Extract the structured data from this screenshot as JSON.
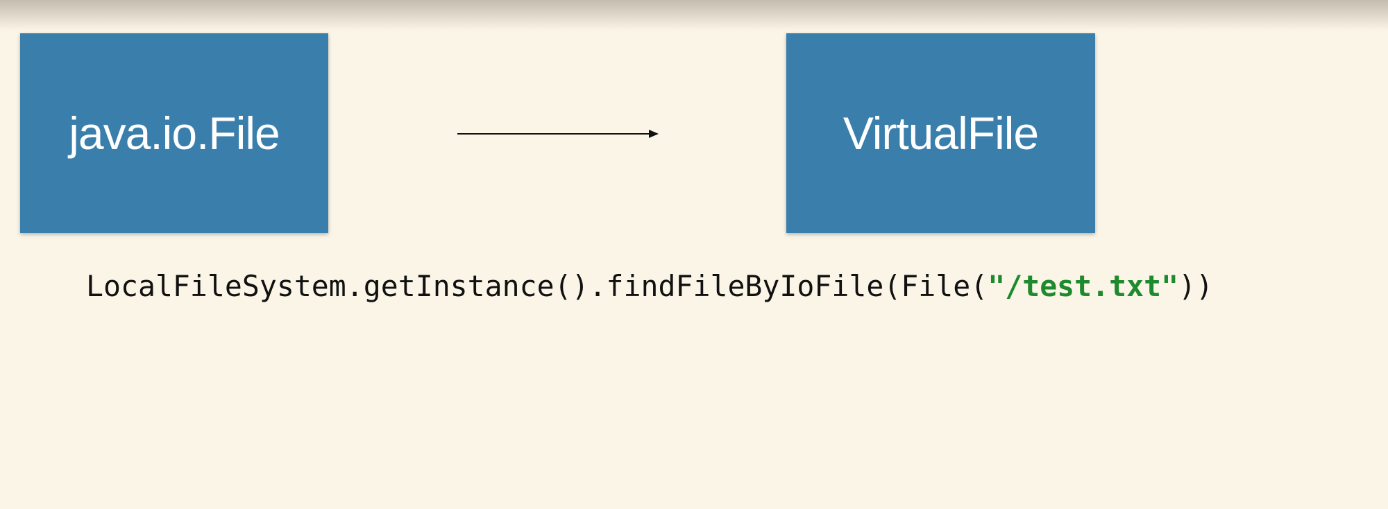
{
  "diagram": {
    "source_box": {
      "label": "java.io.File"
    },
    "target_box": {
      "label": "VirtualFile"
    },
    "arrow": {
      "direction": "left-to-right"
    },
    "code": {
      "call": "LocalFileSystem.getInstance().findFileByIoFile(File(",
      "string_literal": "\"/test.txt\"",
      "closing": "))"
    }
  },
  "colors": {
    "background": "#fbf5e7",
    "box_fill": "#3a7fab",
    "box_text": "#ffffff",
    "code_text": "#111111",
    "string_literal": "#1e8a2e"
  }
}
